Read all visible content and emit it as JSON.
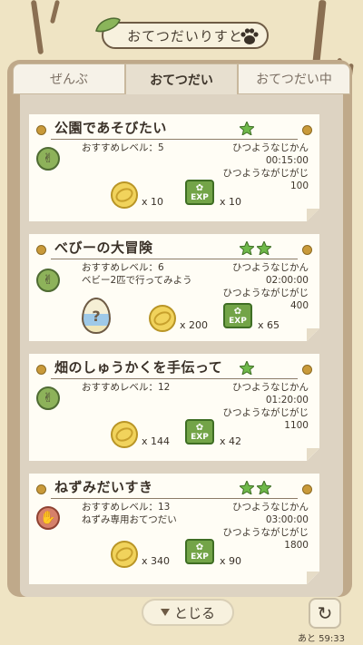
{
  "header": {
    "title": "おてつだいりすと"
  },
  "tabs": [
    {
      "label": "ぜんぶ"
    },
    {
      "label": "おてつだい"
    },
    {
      "label": "おてつだい中"
    }
  ],
  "cards": [
    {
      "title": "公園であそびたい",
      "stars": 1,
      "level_label": "おすすめレベル：5",
      "note": "",
      "time_label": "ひつようなじかん",
      "time_value": "00:15:00",
      "cost_label": "ひつようながじがじ",
      "cost_value": "100",
      "coin_qty": "x 10",
      "exp_qty": "x 10",
      "badge": "peace"
    },
    {
      "title": "べびーの大冒険",
      "stars": 2,
      "level_label": "おすすめレベル：6",
      "note": "ベビー2匹で行ってみよう",
      "time_label": "ひつようなじかん",
      "time_value": "02:00:00",
      "cost_label": "ひつようながじがじ",
      "cost_value": "400",
      "coin_qty": "x 200",
      "exp_qty": "x 65",
      "badge": "peace"
    },
    {
      "title": "畑のしゅうかくを手伝って",
      "stars": 1,
      "level_label": "おすすめレベル：12",
      "note": "",
      "time_label": "ひつようなじかん",
      "time_value": "01:20:00",
      "cost_label": "ひつようながじがじ",
      "cost_value": "1100",
      "coin_qty": "x 144",
      "exp_qty": "x 42",
      "badge": "peace"
    },
    {
      "title": "ねずみだいすき",
      "stars": 2,
      "level_label": "おすすめレベル：13",
      "note": "ねずみ専用おてつだい",
      "time_label": "ひつようなじかん",
      "time_value": "03:00:00",
      "cost_label": "ひつようながじがじ",
      "cost_value": "1800",
      "coin_qty": "x 340",
      "exp_qty": "x 90",
      "badge": "paper"
    }
  ],
  "exp_label": "EXP",
  "egg_symbol": "?",
  "close_label": "とじる",
  "timer": "あと 59:33",
  "colors": {
    "star": "#6fb94a",
    "coin": "#f1d35c",
    "exp": "#73a448"
  }
}
